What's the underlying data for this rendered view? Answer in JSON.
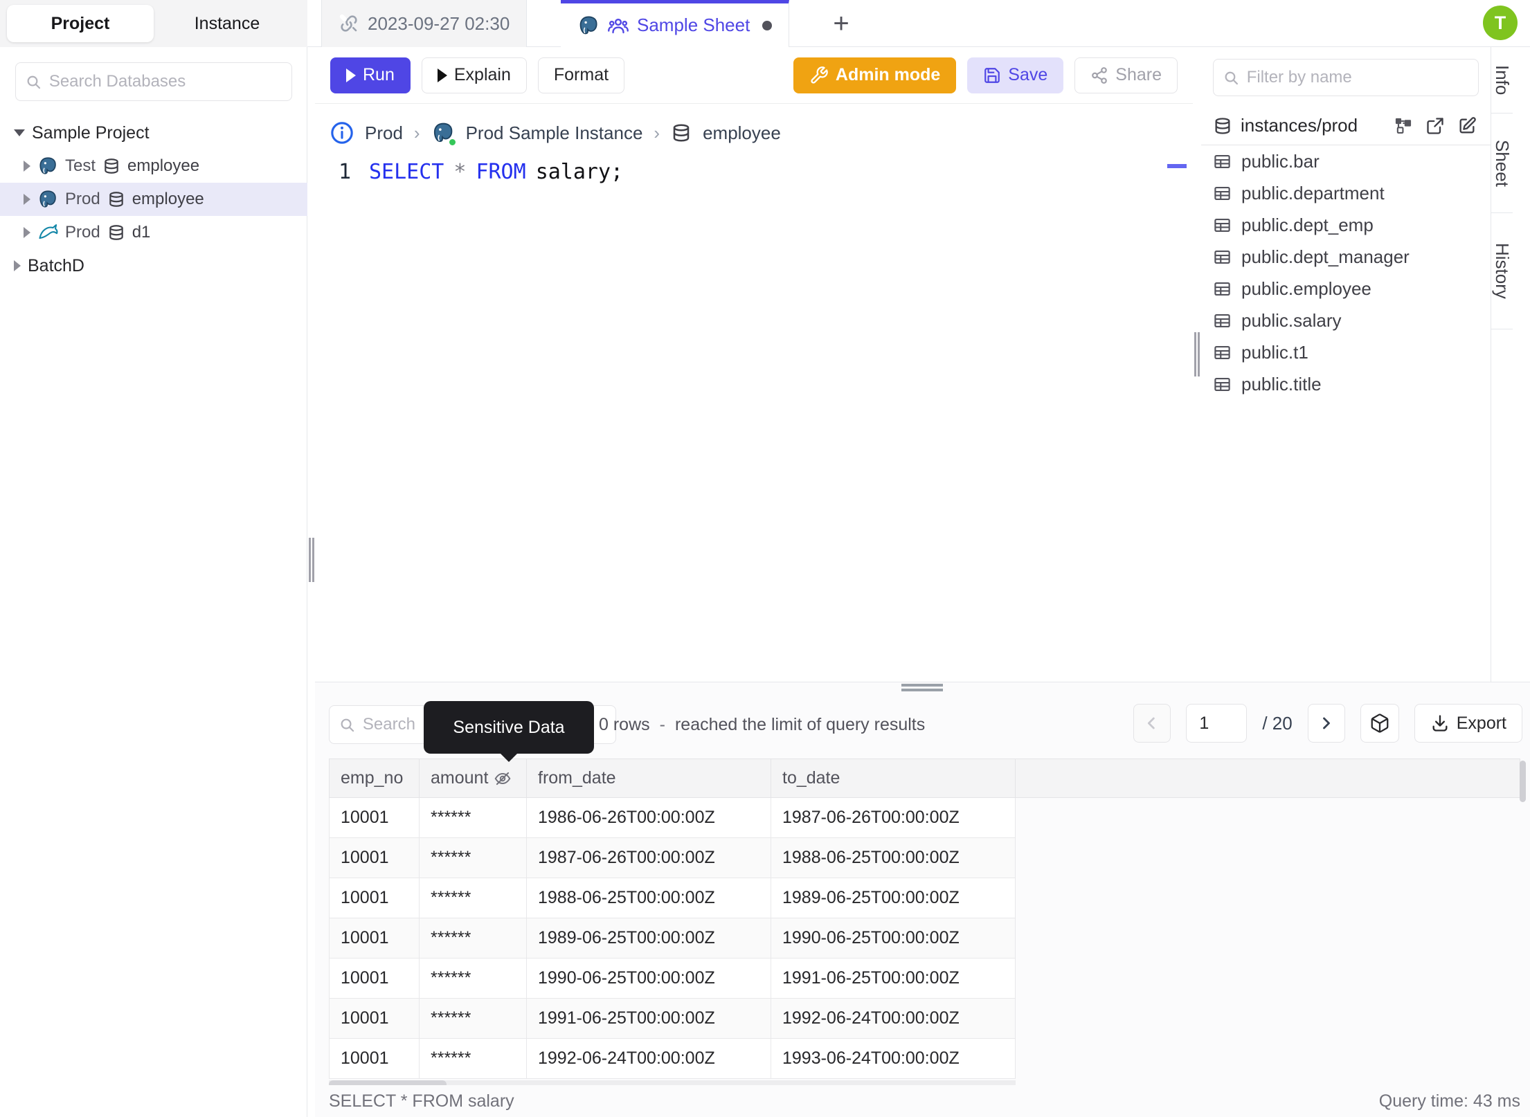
{
  "app": {
    "avatar_letter": "T"
  },
  "sidebar": {
    "tabs": {
      "project": "Project",
      "instance": "Instance"
    },
    "search_placeholder": "Search Databases",
    "tree": {
      "project_label": "Sample Project",
      "items": [
        {
          "env": "Test",
          "database": "employee"
        },
        {
          "env": "Prod",
          "database": "employee"
        },
        {
          "env": "Prod",
          "database": "d1"
        }
      ],
      "batch_label": "BatchD"
    }
  },
  "tabbar": {
    "tab1_label": "2023-09-27 02:30",
    "tab2_label": "Sample Sheet",
    "new_tab_label": "+"
  },
  "toolbar": {
    "run": "Run",
    "explain": "Explain",
    "format": "Format",
    "admin_mode": "Admin mode",
    "save": "Save",
    "share": "Share"
  },
  "breadcrumb": {
    "environment": "Prod",
    "instance": "Prod Sample Instance",
    "database": "employee",
    "sep": "›"
  },
  "editor": {
    "line_number": "1",
    "sql": {
      "kw1": "SELECT",
      "star": "*",
      "kw2": "FROM",
      "rest": "salary;"
    }
  },
  "schema_panel": {
    "filter_placeholder": "Filter by name",
    "header": "instances/prod",
    "tables": [
      "public.bar",
      "public.department",
      "public.dept_emp",
      "public.dept_manager",
      "public.employee",
      "public.salary",
      "public.t1",
      "public.title"
    ]
  },
  "side_tabs": {
    "info": "Info",
    "sheet": "Sheet",
    "history": "History"
  },
  "results": {
    "search_placeholder": "Search",
    "tooltip": "Sensitive Data",
    "row_count": "0 rows",
    "dash": "-",
    "limit_note": "reached the limit of query results",
    "page": "1",
    "page_total": "/ 20",
    "export_label": "Export",
    "table": {
      "columns": [
        "emp_no",
        "amount",
        "from_date",
        "to_date"
      ],
      "rows": [
        [
          "10001",
          "******",
          "1986-06-26T00:00:00Z",
          "1987-06-26T00:00:00Z"
        ],
        [
          "10001",
          "******",
          "1987-06-26T00:00:00Z",
          "1988-06-25T00:00:00Z"
        ],
        [
          "10001",
          "******",
          "1988-06-25T00:00:00Z",
          "1989-06-25T00:00:00Z"
        ],
        [
          "10001",
          "******",
          "1989-06-25T00:00:00Z",
          "1990-06-25T00:00:00Z"
        ],
        [
          "10001",
          "******",
          "1990-06-25T00:00:00Z",
          "1991-06-25T00:00:00Z"
        ],
        [
          "10001",
          "******",
          "1991-06-25T00:00:00Z",
          "1992-06-24T00:00:00Z"
        ],
        [
          "10001",
          "******",
          "1992-06-24T00:00:00Z",
          "1993-06-24T00:00:00Z"
        ]
      ]
    },
    "status_left": "SELECT * FROM salary",
    "status_right": "Query time: 43 ms"
  }
}
